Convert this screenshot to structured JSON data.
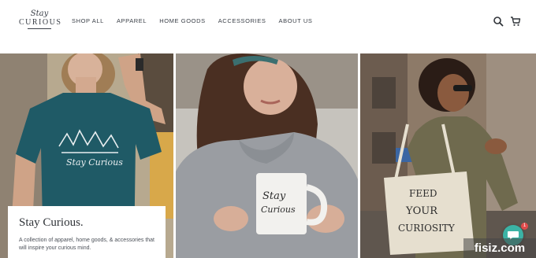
{
  "brand": {
    "logo_script": "Stay",
    "logo_word": "CURIOUS"
  },
  "nav": {
    "items": [
      {
        "label": "SHOP ALL"
      },
      {
        "label": "APPAREL"
      },
      {
        "label": "HOME GOODS"
      },
      {
        "label": "ACCESSORIES"
      },
      {
        "label": "ABOUT US"
      }
    ]
  },
  "header": {
    "search_icon": "search-icon",
    "cart_icon": "cart-icon"
  },
  "hero": {
    "panels": [
      {
        "subject": "woman in teal tee",
        "tee_print": "Stay Curious"
      },
      {
        "subject": "woman holding mug",
        "mug_print_1": "Stay",
        "mug_print_2": "Curious"
      },
      {
        "subject": "woman with tote bag",
        "tote_print_1": "FEED",
        "tote_print_2": "YOUR",
        "tote_print_3": "CURIOSITY"
      }
    ]
  },
  "promo": {
    "title": "Stay Curious.",
    "text": "A collection of apparel, home goods, & accessories that will inspire your curious mind."
  },
  "chat": {
    "badge_count": "1",
    "icon": "chat-icon"
  },
  "watermark": {
    "text": "fisiz.com"
  },
  "colors": {
    "teal_shirt": "#1f5a66",
    "sweater": "#9a9da2",
    "jacket": "#6f6a4e",
    "chat": "#3bb3a5"
  }
}
